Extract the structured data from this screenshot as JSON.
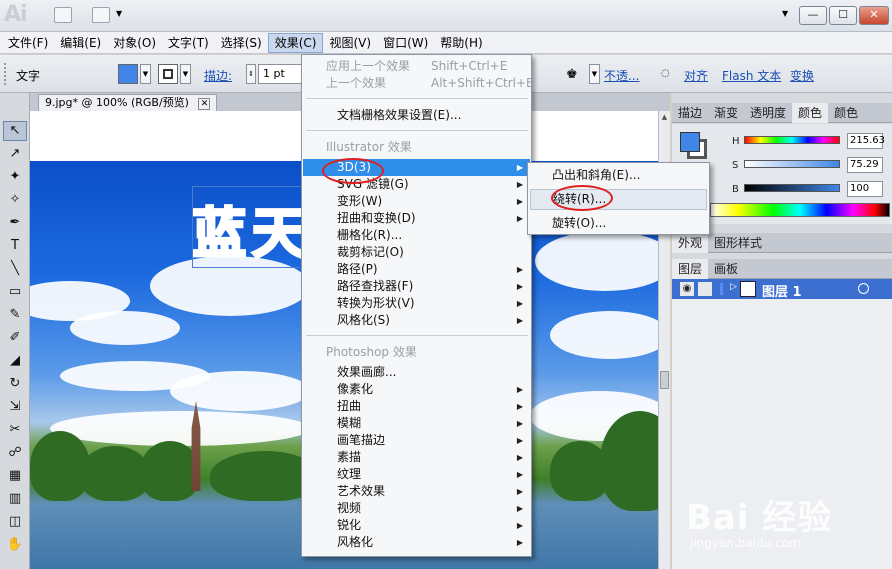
{
  "app": {
    "logo": "Ai",
    "window_buttons": [
      "▼",
      "—",
      "☐",
      "✕"
    ]
  },
  "menubar": [
    {
      "label": "文件(F)",
      "active": false
    },
    {
      "label": "编辑(E)",
      "active": false
    },
    {
      "label": "对象(O)",
      "active": false
    },
    {
      "label": "文字(T)",
      "active": false
    },
    {
      "label": "选择(S)",
      "active": false
    },
    {
      "label": "效果(C)",
      "active": true
    },
    {
      "label": "视图(V)",
      "active": false
    },
    {
      "label": "窗口(W)",
      "active": false
    },
    {
      "label": "帮助(H)",
      "active": false
    }
  ],
  "controlbar": {
    "mode_label": "文字",
    "fill_color": "#3f86e8",
    "stroke_label": "描边:",
    "stroke_value": "1 pt",
    "opacity_label": "不透...",
    "align_label": "对齐",
    "flash_text_label": "Flash 文本",
    "transform_label": "变换"
  },
  "document": {
    "tab_title": "9.jpg* @ 100% (RGB/预览)",
    "close_glyph": "✕",
    "artwork_text": "蓝天"
  },
  "tools": [
    "↖",
    "↗",
    "✦",
    "✧",
    "✒",
    "T",
    "╲",
    "▭",
    "✎",
    "✐",
    "◢",
    "↻",
    "⇲",
    "✂",
    "☍",
    "▦",
    "▥",
    "◫",
    "✋"
  ],
  "effect_menu": {
    "items": [
      {
        "label": "应用上一个效果",
        "shortcut": "Shift+Ctrl+E",
        "type": "disabled"
      },
      {
        "label": "上一个效果",
        "shortcut": "Alt+Shift+Ctrl+E",
        "type": "disabled"
      },
      {
        "type": "separator"
      },
      {
        "label": "文档栅格效果设置(E)...",
        "type": "item"
      },
      {
        "type": "separator"
      },
      {
        "label": "Illustrator 效果",
        "type": "section"
      },
      {
        "label": "3D(3)",
        "type": "submenu",
        "highlighted": true
      },
      {
        "label": "SVG 滤镜(G)",
        "type": "submenu"
      },
      {
        "label": "变形(W)",
        "type": "submenu"
      },
      {
        "label": "扭曲和变换(D)",
        "type": "submenu"
      },
      {
        "label": "栅格化(R)...",
        "type": "item"
      },
      {
        "label": "裁剪标记(O)",
        "type": "item"
      },
      {
        "label": "路径(P)",
        "type": "submenu"
      },
      {
        "label": "路径查找器(F)",
        "type": "submenu"
      },
      {
        "label": "转换为形状(V)",
        "type": "submenu"
      },
      {
        "label": "风格化(S)",
        "type": "submenu"
      },
      {
        "type": "separator"
      },
      {
        "label": "Photoshop 效果",
        "type": "section"
      },
      {
        "label": "效果画廊...",
        "type": "item"
      },
      {
        "label": "像素化",
        "type": "submenu"
      },
      {
        "label": "扭曲",
        "type": "submenu"
      },
      {
        "label": "模糊",
        "type": "submenu"
      },
      {
        "label": "画笔描边",
        "type": "submenu"
      },
      {
        "label": "素描",
        "type": "submenu"
      },
      {
        "label": "纹理",
        "type": "submenu"
      },
      {
        "label": "艺术效果",
        "type": "submenu"
      },
      {
        "label": "视频",
        "type": "submenu"
      },
      {
        "label": "锐化",
        "type": "submenu"
      },
      {
        "label": "风格化",
        "type": "submenu"
      }
    ]
  },
  "submenu_3d": [
    {
      "label": "凸出和斜角(E)...",
      "hover": false
    },
    {
      "label": "绕转(R)...",
      "hover": true
    },
    {
      "label": "旋转(O)...",
      "hover": false
    }
  ],
  "color_panel": {
    "tabs": [
      "描边",
      "渐变",
      "透明度",
      "颜色",
      "颜色"
    ],
    "active_tab": 3,
    "fill_color": "#3f86e8",
    "channels": [
      {
        "name": "H",
        "value": "215.63"
      },
      {
        "name": "S",
        "value": "75.29"
      },
      {
        "name": "B",
        "value": "100"
      }
    ]
  },
  "appearance_panel": {
    "tabs": [
      "外观",
      "图形样式"
    ]
  },
  "layers_panel": {
    "tabs": [
      "图层",
      "画板"
    ],
    "layers": [
      {
        "name": "图层 1"
      }
    ]
  },
  "watermark": {
    "text": "Bai 经验",
    "url": "jingyan.baidu.com"
  }
}
